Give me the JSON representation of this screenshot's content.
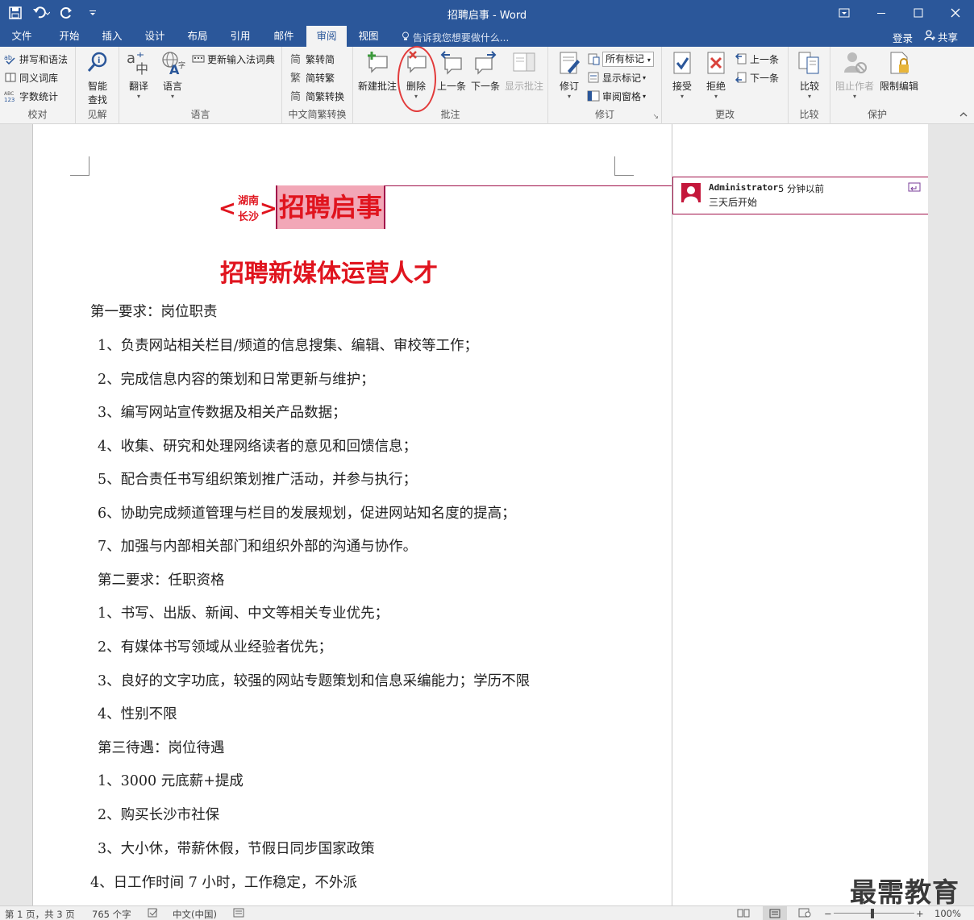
{
  "window": {
    "title": "招聘启事 - Word"
  },
  "qat": {
    "save": "save-icon",
    "undo": "undo-icon",
    "redo": "redo-icon",
    "customize": "customize-icon"
  },
  "tabs": [
    "文件",
    "开始",
    "插入",
    "设计",
    "布局",
    "引用",
    "邮件",
    "审阅",
    "视图"
  ],
  "active_tab": "审阅",
  "tell_me": "告诉我您想要做什么...",
  "account": {
    "login": "登录",
    "share": "共享"
  },
  "ribbon": {
    "proofing": {
      "spelling": "拼写和语法",
      "thesaurus": "同义词库",
      "word_count": "字数统计",
      "label": "校对"
    },
    "insights": {
      "smart_lookup_1": "智能",
      "smart_lookup_2": "查找",
      "label": "见解"
    },
    "language": {
      "translate": "翻译",
      "language": "语言",
      "update_ime": "更新输入法词典",
      "label": "语言"
    },
    "chinese_conv": {
      "to_simplified": "繁转简",
      "to_traditional": "简转繁",
      "convert": "简繁转换",
      "label": "中文简繁转换"
    },
    "comments": {
      "new": "新建批注",
      "delete": "删除",
      "previous": "上一条",
      "next": "下一条",
      "show": "显示批注",
      "label": "批注"
    },
    "tracking": {
      "track": "修订",
      "markup_select": "所有标记",
      "show_markup": "显示标记",
      "review_pane": "审阅窗格",
      "label": "修订"
    },
    "changes": {
      "accept": "接受",
      "reject": "拒绝",
      "previous": "上一条",
      "next": "下一条",
      "label": "更改"
    },
    "compare": {
      "compare": "比较",
      "label": "比较"
    },
    "protect": {
      "block_authors": "阻止作者",
      "restrict": "限制编辑",
      "label": "保护"
    }
  },
  "document": {
    "prefix_open": "<",
    "prefix_line1": "湖南",
    "prefix_line2": "长沙",
    "prefix_close": ">",
    "heading": "招聘启事",
    "subheading": "招聘新媒体运营人才",
    "paragraphs": [
      "第一要求：岗位职责",
      "1、负责网站相关栏目/频道的信息搜集、编辑、审校等工作；",
      "2、完成信息内容的策划和日常更新与维护；",
      "3、编写网站宣传数据及相关产品数据；",
      "4、收集、研究和处理网络读者的意见和回馈信息；",
      "5、配合责任书写组织策划推广活动，并参与执行；",
      "6、协助完成频道管理与栏目的发展规划，促进网站知名度的提高；",
      "7、加强与内部相关部门和组织外部的沟通与协作。",
      "第二要求：任职资格",
      "1、书写、出版、新闻、中文等相关专业优先；",
      "2、有媒体书写领域从业经验者优先；",
      "3、良好的文字功底，较强的网站专题策划和信息采编能力；学历不限",
      "4、性别不限",
      "第三待遇：岗位待遇",
      "1、3000 元底薪+提成",
      "2、购买长沙市社保",
      "3、大小休，带薪休假，节假日同步国家政策",
      "4、日工作时间 7 小时，工作稳定，不外派"
    ]
  },
  "comment": {
    "author": "Administrator",
    "time": "5 分钟以前",
    "text": "三天后开始"
  },
  "watermark": "最需教育",
  "status": {
    "page": "第 1 页，共 3 页",
    "words": "765 个字",
    "language": "中文(中国)",
    "zoom": "100%"
  }
}
